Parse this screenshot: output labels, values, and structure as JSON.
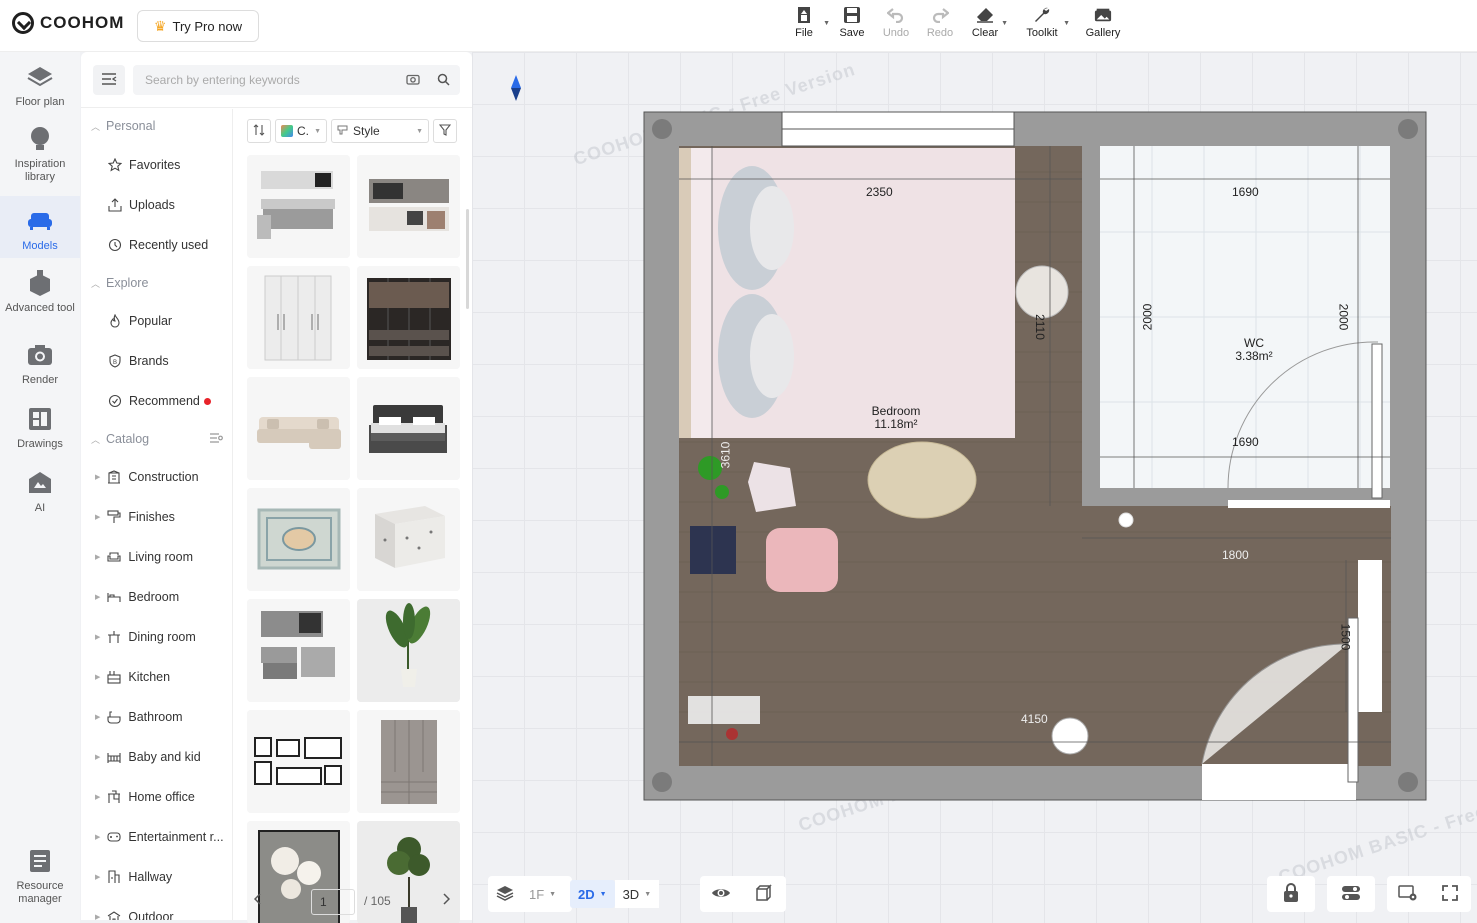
{
  "brand": {
    "name": "COOHOM"
  },
  "header": {
    "try_pro": "Try Pro now",
    "tools": [
      {
        "label": "File",
        "icon": "file-icon",
        "has_menu": true,
        "enabled": true
      },
      {
        "label": "Save",
        "icon": "save-icon",
        "has_menu": false,
        "enabled": true
      },
      {
        "label": "Undo",
        "icon": "undo-icon",
        "has_menu": false,
        "enabled": false
      },
      {
        "label": "Redo",
        "icon": "redo-icon",
        "has_menu": false,
        "enabled": false
      },
      {
        "label": "Clear",
        "icon": "eraser-icon",
        "has_menu": true,
        "enabled": true
      },
      {
        "label": "Toolkit",
        "icon": "wrench-icon",
        "has_menu": true,
        "enabled": true
      },
      {
        "label": "Gallery",
        "icon": "gallery-icon",
        "has_menu": false,
        "enabled": true
      }
    ]
  },
  "rail": {
    "items": [
      {
        "label": "Floor plan",
        "icon": "floor-plan-icon"
      },
      {
        "label": "Inspiration library",
        "icon": "lightbulb-icon"
      },
      {
        "label": "Models",
        "icon": "sofa-icon",
        "active": true
      },
      {
        "label": "Advanced tool",
        "icon": "toolbox-icon"
      },
      {
        "label": "Render",
        "icon": "camera-icon"
      },
      {
        "label": "Drawings",
        "icon": "drawings-icon"
      },
      {
        "label": "AI",
        "icon": "ai-icon"
      }
    ],
    "resource_manager": "Resource manager"
  },
  "panel": {
    "search_placeholder": "Search by entering keywords",
    "sections": {
      "personal": "Personal",
      "explore": "Explore",
      "catalog": "Catalog"
    },
    "personal_items": [
      {
        "label": "Favorites",
        "icon": "star-icon"
      },
      {
        "label": "Uploads",
        "icon": "upload-icon"
      },
      {
        "label": "Recently used",
        "icon": "history-icon"
      }
    ],
    "explore_items": [
      {
        "label": "Popular",
        "icon": "fire-icon"
      },
      {
        "label": "Brands",
        "icon": "brand-icon"
      },
      {
        "label": "Recommend",
        "icon": "recommend-icon",
        "badge_dot": true
      }
    ],
    "catalog_items": [
      {
        "label": "Construction",
        "icon": "construction-icon"
      },
      {
        "label": "Finishes",
        "icon": "paint-roller-icon"
      },
      {
        "label": "Living room",
        "icon": "sofa-outline-icon"
      },
      {
        "label": "Bedroom",
        "icon": "bed-icon"
      },
      {
        "label": "Dining room",
        "icon": "dining-icon"
      },
      {
        "label": "Kitchen",
        "icon": "kitchen-icon"
      },
      {
        "label": "Bathroom",
        "icon": "bathtub-icon"
      },
      {
        "label": "Baby and kid",
        "icon": "crib-icon"
      },
      {
        "label": "Home office",
        "icon": "desk-icon"
      },
      {
        "label": "Entertainment r...",
        "icon": "gamepad-icon"
      },
      {
        "label": "Hallway",
        "icon": "hallway-icon"
      },
      {
        "label": "Outdoor",
        "icon": "outdoor-icon"
      }
    ],
    "filters": {
      "color_label": "C.",
      "style_label": "Style"
    },
    "thumbnails": [
      "l-kitchen",
      "kitchen-unit",
      "wardrobe-white",
      "wardrobe-open",
      "sofa-sectional",
      "bed-dark",
      "rug-patterned",
      "terrazzo-table",
      "kitchen-gray",
      "plant-tall",
      "picture-frames",
      "cabinet-gray",
      "painting-flowers",
      "plant-small"
    ],
    "pagination": {
      "current": "1",
      "total": "/ 105"
    }
  },
  "canvas": {
    "watermark": "COOHOM BASIC - Free Version",
    "rooms": [
      {
        "name": "Bedroom",
        "area": "11.18m²"
      },
      {
        "name": "WC",
        "area": "3.38m²"
      }
    ],
    "dimensions": [
      "2350",
      "1690",
      "2110",
      "2000",
      "2000",
      "1690",
      "3610",
      "1800",
      "1500",
      "4150"
    ],
    "colors": {
      "wall": "#9b9b9b",
      "floor": "#74675c",
      "tile": "#f3f6f8",
      "accent": "#2a6be8"
    }
  },
  "bottom_bar": {
    "floor": "1F",
    "view_2d": "2D",
    "view_3d": "3D"
  }
}
